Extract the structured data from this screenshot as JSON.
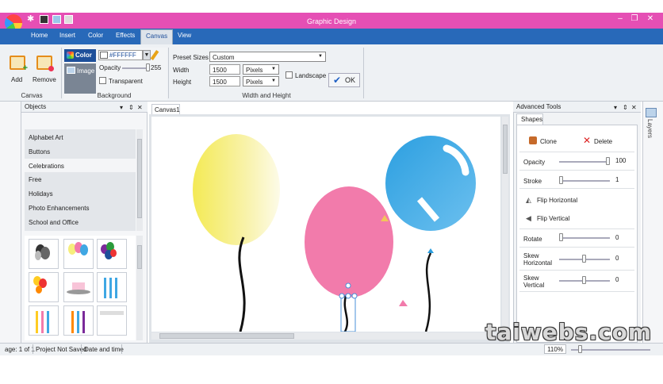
{
  "window": {
    "title": "Graphic Design",
    "minimize": "–",
    "restore": "❐",
    "close": "✕"
  },
  "menu_tabs": [
    "Home",
    "Insert",
    "Color",
    "Effects",
    "Canvas",
    "View"
  ],
  "active_tab": "Canvas",
  "ribbon": {
    "canvas_group": {
      "add_label": "Add",
      "remove_label": "Remove",
      "group_label": "Canvas"
    },
    "background_group": {
      "color_label": "Color",
      "image_label": "Image",
      "hex_value": "#FFFFFF",
      "opacity_label": "Opacity",
      "opacity_value": "255",
      "opacity_fraction": 1.0,
      "transparent_label": "Transparent",
      "group_label": "Background"
    },
    "size_group": {
      "preset_label": "Preset Sizes",
      "preset_value": "Custom",
      "width_label": "Width",
      "width_value": "1500",
      "width_unit": "Pixels",
      "height_label": "Height",
      "height_value": "1500",
      "height_unit": "Pixels",
      "landscape_label": "Landscape",
      "ok_label": "OK",
      "group_label": "Width and Height"
    }
  },
  "objects_panel": {
    "title": "Objects",
    "pin": "▾",
    "dock": "⇕",
    "close": "✕",
    "categories": [
      "Alphabet Art",
      "Buttons",
      "Celebrations",
      "Free",
      "Holidays",
      "Photo Enhancements",
      "School and Office"
    ],
    "selected_category": "Celebrations"
  },
  "canvas": {
    "tab_label": "Canvas1"
  },
  "advanced_tools": {
    "title": "Advanced Tools",
    "tab_label": "Shapes",
    "clone_label": "Clone",
    "delete_label": "Delete",
    "opacity": {
      "label": "Opacity",
      "value": "100",
      "fraction": 1.0
    },
    "stroke": {
      "label": "Stroke",
      "value": "1",
      "fraction": 0.0
    },
    "flip_horizontal_label": "Flip Horizontal",
    "flip_vertical_label": "Flip Vertical",
    "rotate": {
      "label": "Rotate",
      "value": "0",
      "fraction": 0.0
    },
    "skew_horizontal": {
      "label_line1": "Skew",
      "label_line2": "Horizontal",
      "value": "0",
      "fraction": 0.5
    },
    "skew_vertical": {
      "label_line1": "Skew",
      "label_line2": "Vertical",
      "value": "0",
      "fraction": 0.5
    }
  },
  "layers_label": "Layers",
  "status_bar": {
    "page": "age: 1 of 1",
    "project_status": "Project Not Saved",
    "date_time": "Date and time",
    "zoom": "110%"
  },
  "watermark": "taiwebs.com",
  "colors": {
    "title_bar": "#e54fb4",
    "menu_bar": "#2869b9",
    "balloon_yellow": "#f6ee7c",
    "balloon_pink": "#f27bab",
    "balloon_blue": "#3fa7e3"
  }
}
